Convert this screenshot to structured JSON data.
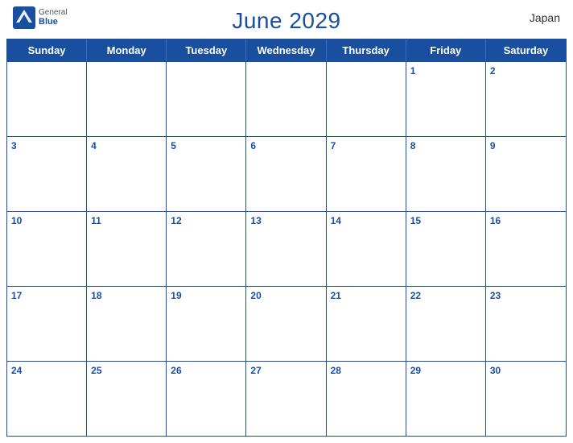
{
  "header": {
    "title": "June 2029",
    "country": "Japan",
    "logo": {
      "general": "General",
      "blue": "Blue"
    }
  },
  "days": {
    "headers": [
      "Sunday",
      "Monday",
      "Tuesday",
      "Wednesday",
      "Thursday",
      "Friday",
      "Saturday"
    ]
  },
  "weeks": [
    [
      null,
      null,
      null,
      null,
      null,
      1,
      2
    ],
    [
      3,
      4,
      5,
      6,
      7,
      8,
      9
    ],
    [
      10,
      11,
      12,
      13,
      14,
      15,
      16
    ],
    [
      17,
      18,
      19,
      20,
      21,
      22,
      23
    ],
    [
      24,
      25,
      26,
      27,
      28,
      29,
      30
    ]
  ]
}
